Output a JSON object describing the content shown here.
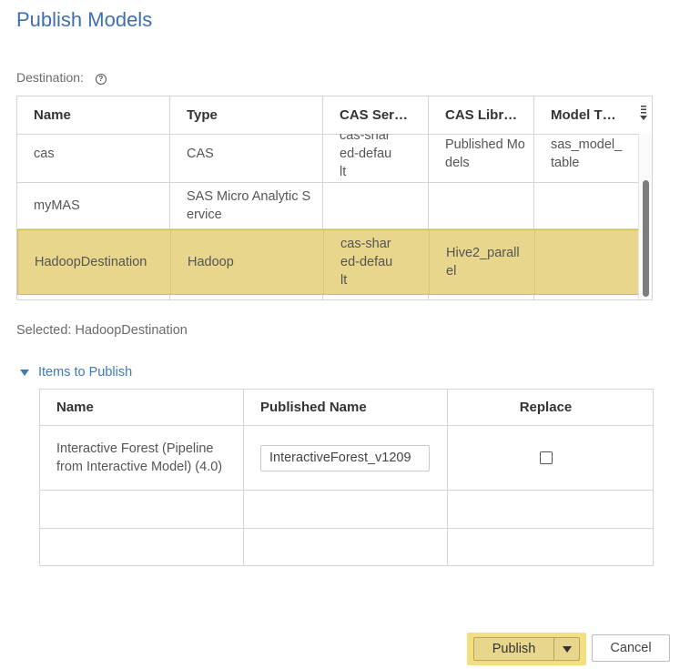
{
  "dialog": {
    "title": "Publish Models"
  },
  "destination": {
    "label": "Destination:",
    "help_icon": "help-circle-icon",
    "columns": [
      "Name",
      "Type",
      "CAS Ser…",
      "CAS Libr…",
      "Model T…"
    ],
    "rows": [
      {
        "name": "cas",
        "type": "CAS",
        "cas_server": "cas-shared-default",
        "cas_library": "Published Models",
        "model_table": "sas_model_table",
        "selected": false
      },
      {
        "name": "myMAS",
        "type": "SAS Micro Analytic Service",
        "cas_server": "",
        "cas_library": "",
        "model_table": "",
        "selected": false
      },
      {
        "name": "HadoopDestination",
        "type": "Hadoop",
        "cas_server": "cas-shared-default",
        "cas_library": "Hive2_parallel",
        "model_table": "",
        "selected": true
      }
    ]
  },
  "selected_text": "Selected: HadoopDestination",
  "items": {
    "toggle_label": "Items to Publish",
    "columns": [
      "Name",
      "Published Name",
      "Replace"
    ],
    "rows": [
      {
        "name": "Interactive Forest (Pipeline from Interactive Model) (4.0)",
        "published_name": "InteractiveForest_v1209",
        "replace": false
      }
    ]
  },
  "footer": {
    "publish_label": "Publish",
    "cancel_label": "Cancel"
  },
  "colors": {
    "title": "#3e6fb0",
    "selection": "#e8d68c",
    "link": "#3e79b8"
  }
}
